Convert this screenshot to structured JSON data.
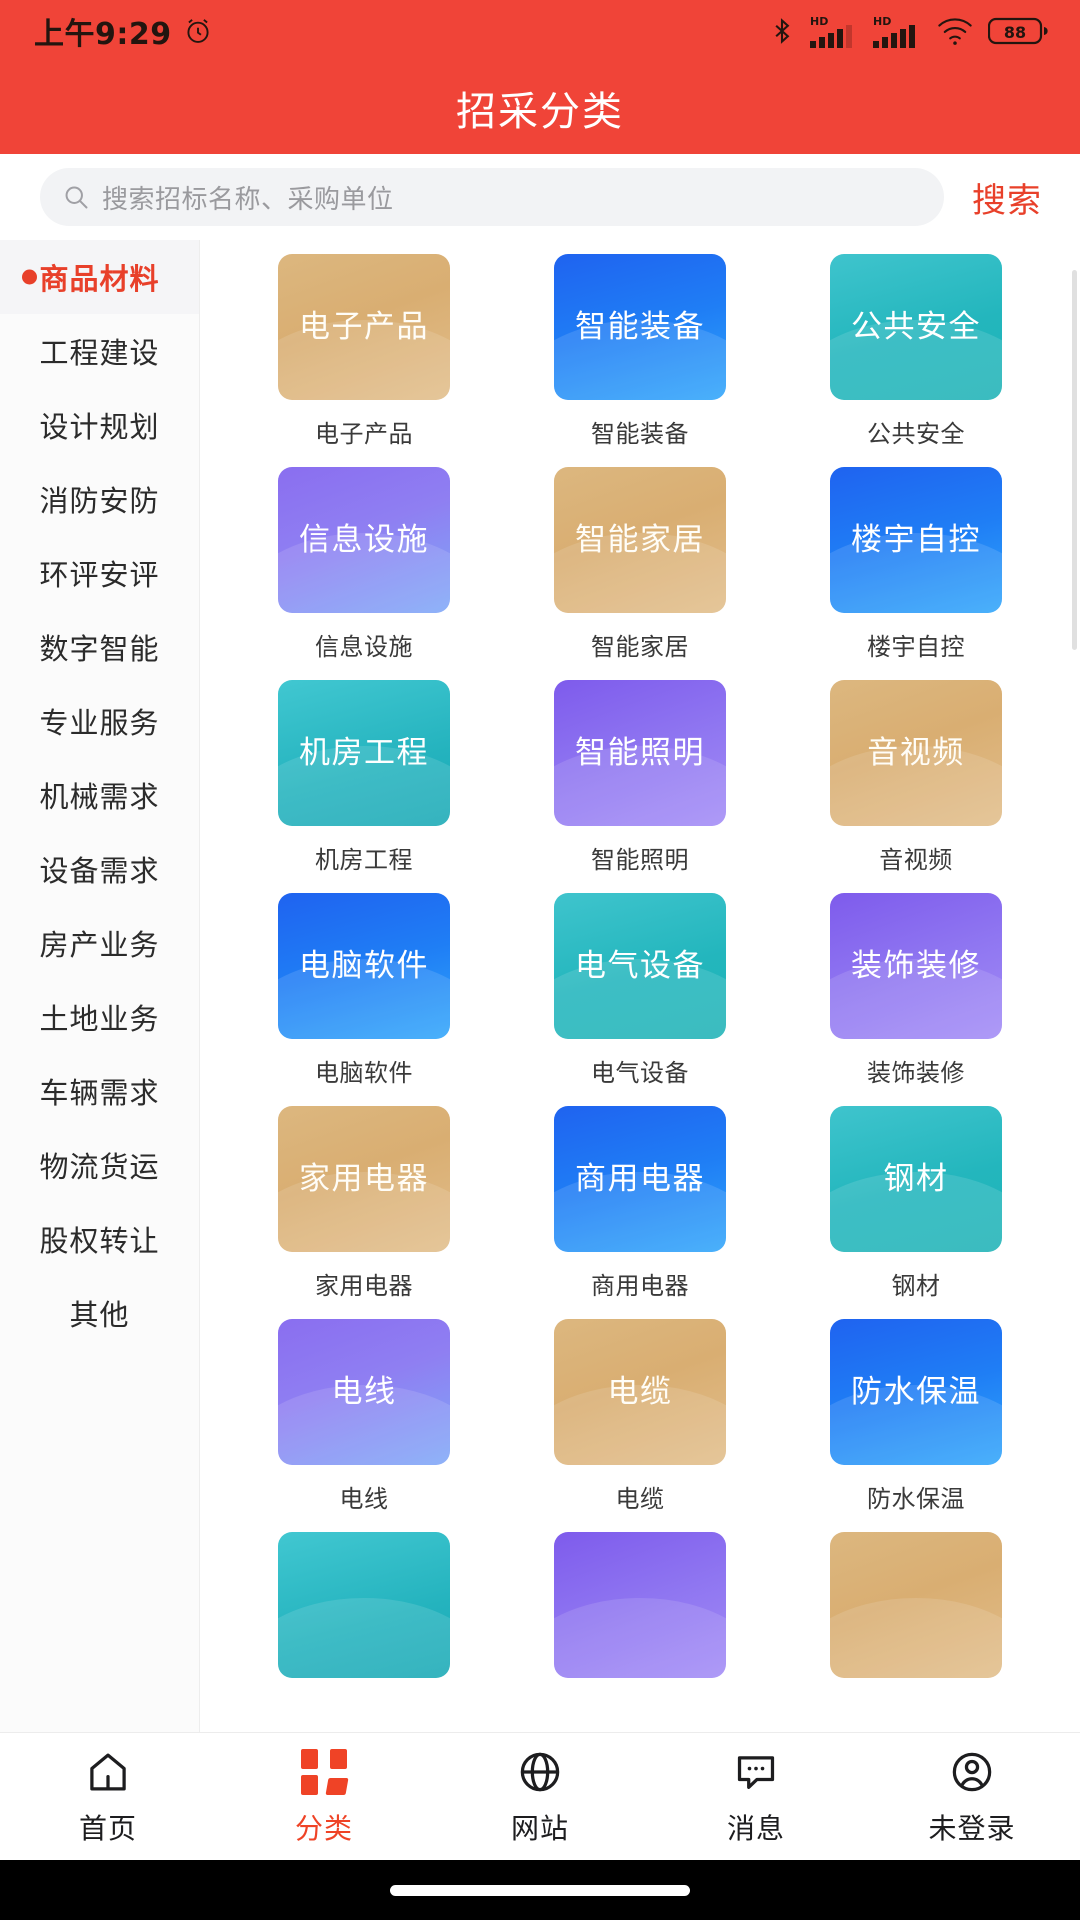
{
  "status_bar": {
    "time": "上午9:29",
    "alarm_icon": "alarm-icon",
    "bluetooth_icon": "bluetooth-icon",
    "signal_1": {
      "icon": "signal-icon",
      "label": "HD"
    },
    "signal_2": {
      "icon": "signal-icon",
      "label": "HD"
    },
    "wifi_icon": "wifi-icon",
    "battery": "88"
  },
  "header": {
    "title": "招采分类"
  },
  "search": {
    "icon": "search-icon",
    "placeholder": "搜索招标名称、采购单位",
    "value": "",
    "button_label": "搜索"
  },
  "sidebar": {
    "active_index": 0,
    "items": [
      {
        "label": "商品材料"
      },
      {
        "label": "工程建设"
      },
      {
        "label": "设计规划"
      },
      {
        "label": "消防安防"
      },
      {
        "label": "环评安评"
      },
      {
        "label": "数字智能"
      },
      {
        "label": "专业服务"
      },
      {
        "label": "机械需求"
      },
      {
        "label": "设备需求"
      },
      {
        "label": "房产业务"
      },
      {
        "label": "土地业务"
      },
      {
        "label": "车辆需求"
      },
      {
        "label": "物流货运"
      },
      {
        "label": "股权转让"
      },
      {
        "label": "其他"
      }
    ]
  },
  "grid": {
    "items": [
      {
        "label": "电子产品",
        "caption": "电子产品",
        "theme": "g-gold",
        "gold": true
      },
      {
        "label": "智能装备",
        "caption": "智能装备",
        "theme": "g-blue",
        "gold": false
      },
      {
        "label": "公共安全",
        "caption": "公共安全",
        "theme": "g-teal",
        "gold": false
      },
      {
        "label": "信息设施",
        "caption": "信息设施",
        "theme": "g-purple",
        "gold": false
      },
      {
        "label": "智能家居",
        "caption": "智能家居",
        "theme": "g-gold",
        "gold": true
      },
      {
        "label": "楼宇自控",
        "caption": "楼宇自控",
        "theme": "g-blue",
        "gold": false
      },
      {
        "label": "机房工程",
        "caption": "机房工程",
        "theme": "g-cyan",
        "gold": false
      },
      {
        "label": "智能照明",
        "caption": "智能照明",
        "theme": "g-violet",
        "gold": false
      },
      {
        "label": "音视频",
        "caption": "音视频",
        "theme": "g-gold",
        "gold": true
      },
      {
        "label": "电脑软件",
        "caption": "电脑软件",
        "theme": "g-blue",
        "gold": false
      },
      {
        "label": "电气设备",
        "caption": "电气设备",
        "theme": "g-teal",
        "gold": false
      },
      {
        "label": "装饰装修",
        "caption": "装饰装修",
        "theme": "g-violet",
        "gold": false
      },
      {
        "label": "家用电器",
        "caption": "家用电器",
        "theme": "g-gold",
        "gold": true
      },
      {
        "label": "商用电器",
        "caption": "商用电器",
        "theme": "g-blue",
        "gold": false
      },
      {
        "label": "钢材",
        "caption": "钢材",
        "theme": "g-teal",
        "gold": false
      },
      {
        "label": "电线",
        "caption": "电线",
        "theme": "g-purple",
        "gold": false
      },
      {
        "label": "电缆",
        "caption": "电缆",
        "theme": "g-gold",
        "gold": true
      },
      {
        "label": "防水保温",
        "caption": "防水保温",
        "theme": "g-blue",
        "gold": false
      },
      {
        "label": "",
        "caption": "",
        "theme": "g-cyan",
        "gold": false
      },
      {
        "label": "",
        "caption": "",
        "theme": "g-violet",
        "gold": false
      },
      {
        "label": "",
        "caption": "",
        "theme": "g-gold",
        "gold": true
      }
    ]
  },
  "tabbar": {
    "active_index": 1,
    "items": [
      {
        "label": "首页",
        "icon": "home-icon"
      },
      {
        "label": "分类",
        "icon": "grid-icon"
      },
      {
        "label": "网站",
        "icon": "globe-icon"
      },
      {
        "label": "消息",
        "icon": "message-icon"
      },
      {
        "label": "未登录",
        "icon": "user-icon"
      }
    ]
  },
  "colors": {
    "brand_red": "#f04438",
    "accent_red": "#e8402a",
    "tab_active": "#ef4326",
    "sidebar_bg": "#fbfbfb",
    "search_bg": "#f2f3f5"
  }
}
